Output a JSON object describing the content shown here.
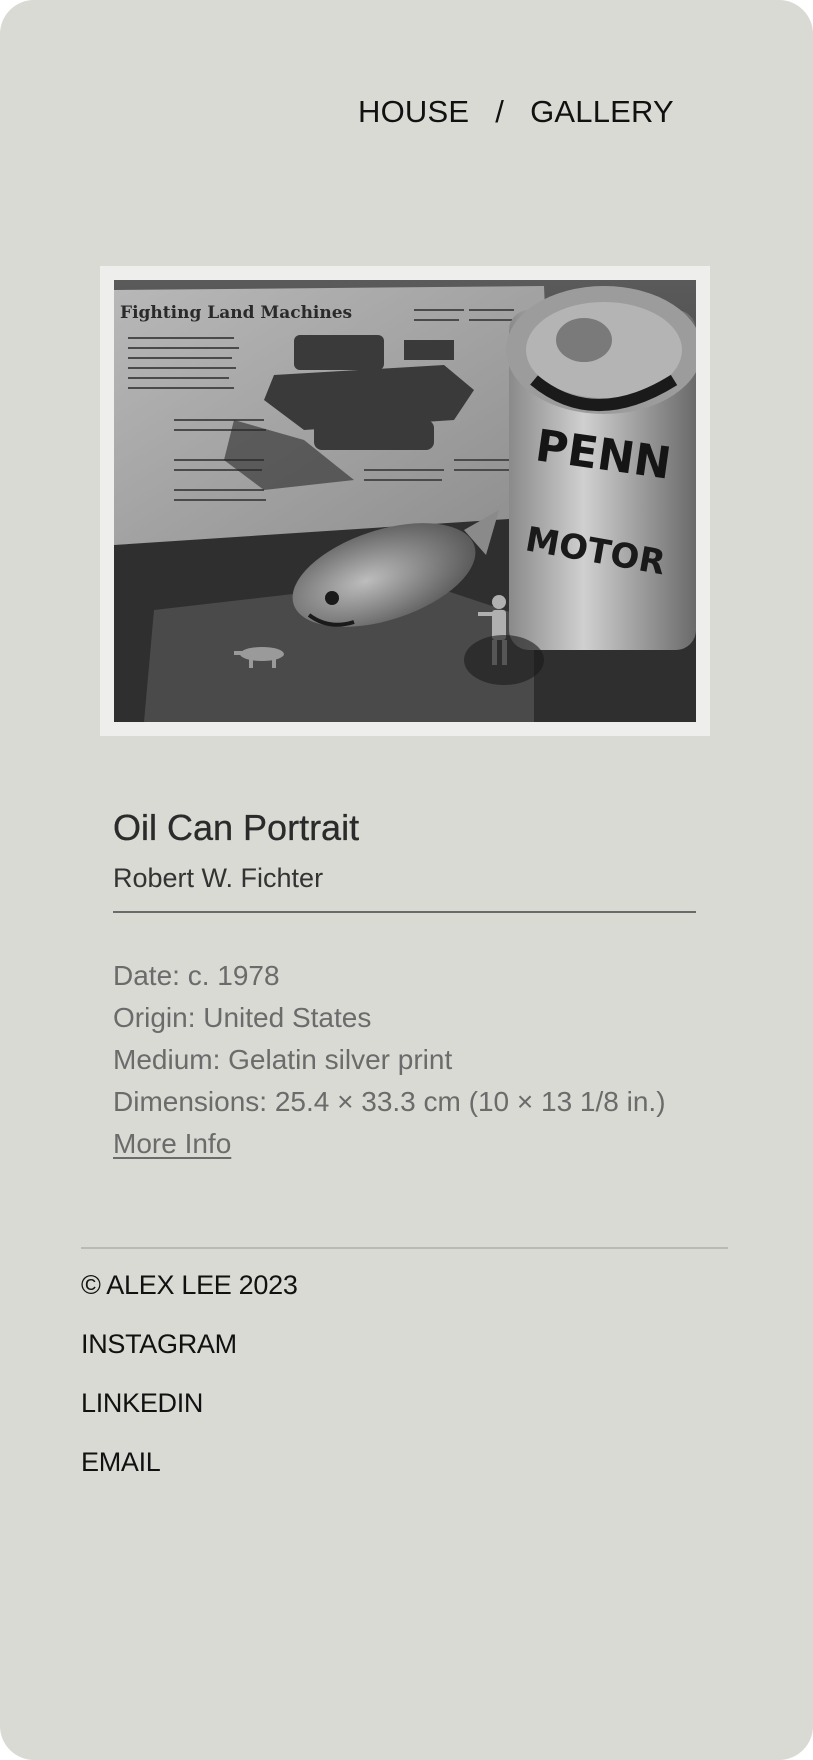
{
  "nav": {
    "house_label": "HOUSE",
    "separator": "/",
    "gallery_label": "GALLERY"
  },
  "artwork": {
    "image_caption_text": "Fighting Land Machines",
    "title": "Oil Can Portrait",
    "artist": "Robert W. Fichter",
    "date": "Date: c. 1978",
    "origin": "Origin: United States",
    "medium": "Medium: Gelatin silver print",
    "dimensions": "Dimensions: 25.4 × 33.3 cm (10 × 13 1/8 in.)",
    "more_info_label": "More Info",
    "can_text_1": "PENN",
    "can_text_2": "MOTOR"
  },
  "footer": {
    "copyright": "© ALEX LEE 2023",
    "instagram_label": "INSTAGRAM",
    "linkedin_label": "LINKEDIN",
    "email_label": "EMAIL"
  },
  "colors": {
    "background": "#d9dad4",
    "text_primary": "#111111",
    "text_secondary": "#6b6b6b"
  }
}
